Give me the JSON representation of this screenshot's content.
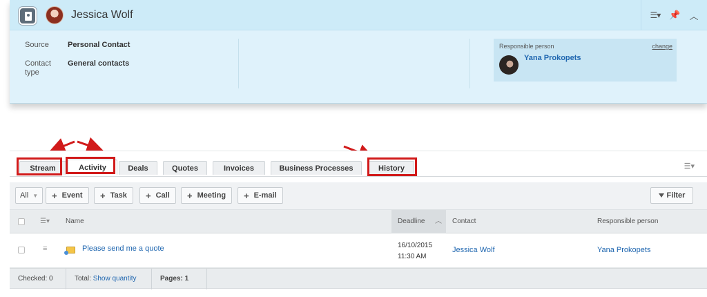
{
  "contact": {
    "name": "Jessica Wolf",
    "fields": [
      {
        "label": "Source",
        "value": "Personal Contact"
      },
      {
        "label": "Contact type",
        "value": "General contacts"
      }
    ],
    "responsible": {
      "label": "Responsible person",
      "change": "change",
      "name": "Yana Prokopets"
    }
  },
  "tabs": [
    "Stream",
    "Activity",
    "Deals",
    "Quotes",
    "Invoices",
    "Business Processes",
    "History"
  ],
  "toolbar": {
    "all": "All",
    "buttons": [
      "Event",
      "Task",
      "Call",
      "Meeting",
      "E-mail"
    ],
    "filter": "Filter"
  },
  "grid": {
    "columns": {
      "name": "Name",
      "deadline": "Deadline",
      "contact": "Contact",
      "responsible": "Responsible person"
    },
    "rows": [
      {
        "name": "Please send me a quote",
        "deadline_date": "16/10/2015",
        "deadline_time": "11:30 AM",
        "contact": "Jessica Wolf",
        "responsible": "Yana Prokopets"
      }
    ],
    "footer": {
      "checked": "Checked: 0",
      "total_label": "Total:",
      "total_link": "Show quantity",
      "pages": "Pages: 1"
    }
  },
  "colors": {
    "highlight": "#d11a1a",
    "link": "#2067b0",
    "card_bg": "#dff2fb"
  }
}
